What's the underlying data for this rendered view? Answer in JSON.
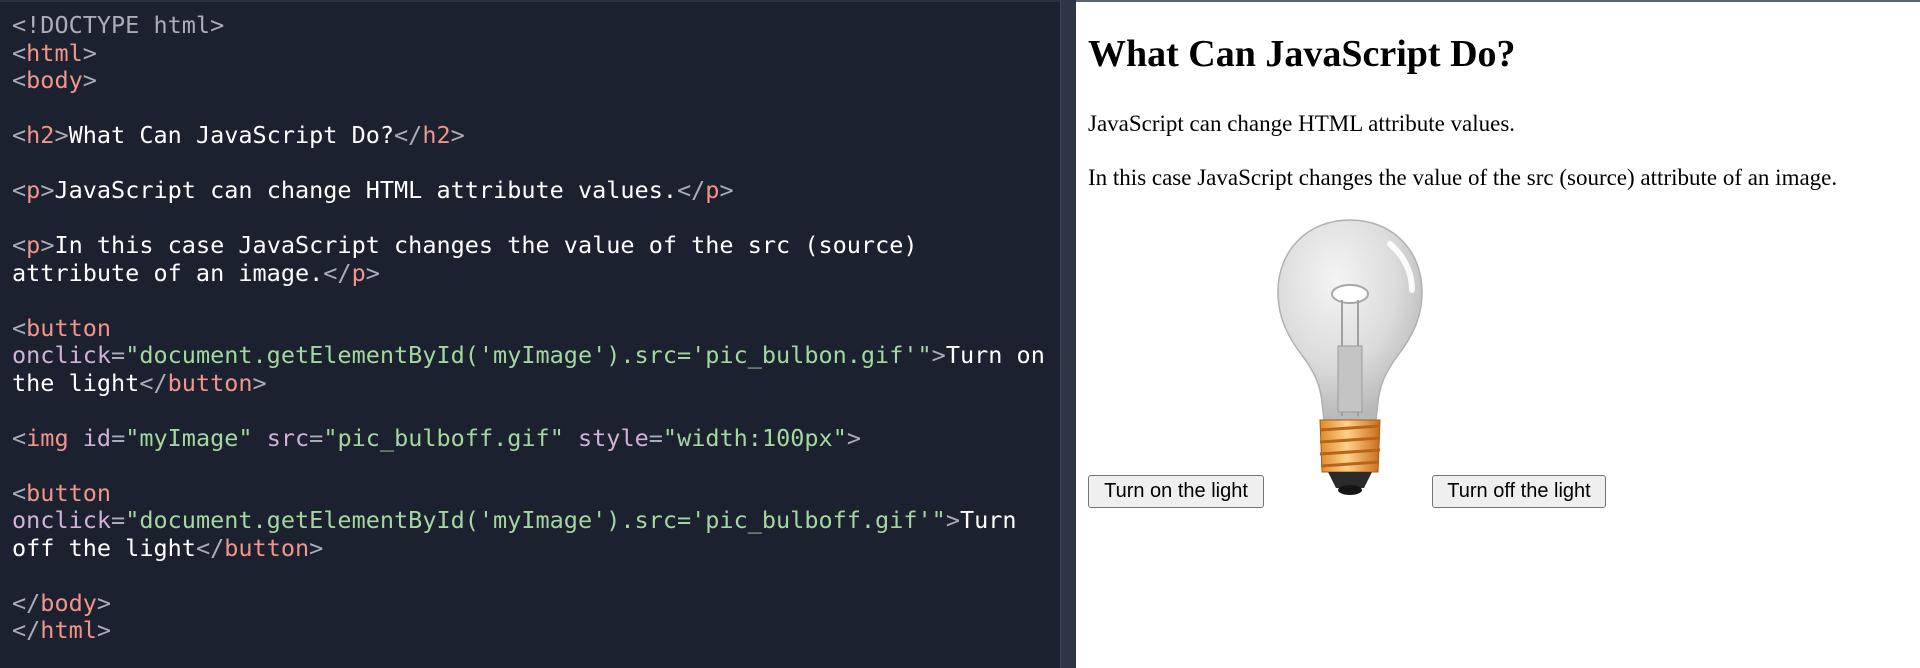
{
  "editor": {
    "lines": [
      [
        {
          "t": "doc",
          "v": "<!DOCTYPE html>"
        }
      ],
      [
        {
          "t": "brk",
          "v": "<"
        },
        {
          "t": "tag",
          "v": "html"
        },
        {
          "t": "brk",
          "v": ">"
        }
      ],
      [
        {
          "t": "brk",
          "v": "<"
        },
        {
          "t": "tag",
          "v": "body"
        },
        {
          "t": "brk",
          "v": ">"
        }
      ],
      [],
      [
        {
          "t": "brk",
          "v": "<"
        },
        {
          "t": "tag",
          "v": "h2"
        },
        {
          "t": "brk",
          "v": ">"
        },
        {
          "t": "txt",
          "v": "What Can JavaScript Do?"
        },
        {
          "t": "brk",
          "v": "</"
        },
        {
          "t": "tag",
          "v": "h2"
        },
        {
          "t": "brk",
          "v": ">"
        }
      ],
      [],
      [
        {
          "t": "brk",
          "v": "<"
        },
        {
          "t": "tag",
          "v": "p"
        },
        {
          "t": "brk",
          "v": ">"
        },
        {
          "t": "txt",
          "v": "JavaScript can change HTML attribute values."
        },
        {
          "t": "brk",
          "v": "</"
        },
        {
          "t": "tag",
          "v": "p"
        },
        {
          "t": "brk",
          "v": ">"
        }
      ],
      [],
      [
        {
          "t": "brk",
          "v": "<"
        },
        {
          "t": "tag",
          "v": "p"
        },
        {
          "t": "brk",
          "v": ">"
        },
        {
          "t": "txt",
          "v": "In this case JavaScript changes the value of the src (source)"
        }
      ],
      [
        {
          "t": "txt",
          "v": "attribute of an image."
        },
        {
          "t": "brk",
          "v": "</"
        },
        {
          "t": "tag",
          "v": "p"
        },
        {
          "t": "brk",
          "v": ">"
        }
      ],
      [],
      [
        {
          "t": "brk",
          "v": "<"
        },
        {
          "t": "tag",
          "v": "button"
        }
      ],
      [
        {
          "t": "attr",
          "v": "onclick"
        },
        {
          "t": "brk",
          "v": "="
        },
        {
          "t": "str",
          "v": "\"document.getElementById('myImage').src='pic_bulbon.gif'\""
        },
        {
          "t": "brk",
          "v": ">"
        },
        {
          "t": "txt",
          "v": "Turn on"
        }
      ],
      [
        {
          "t": "txt",
          "v": "the light"
        },
        {
          "t": "brk",
          "v": "</"
        },
        {
          "t": "tag",
          "v": "button"
        },
        {
          "t": "brk",
          "v": ">"
        }
      ],
      [],
      [
        {
          "t": "brk",
          "v": "<"
        },
        {
          "t": "tag",
          "v": "img"
        },
        {
          "t": "txt",
          "v": " "
        },
        {
          "t": "attr",
          "v": "id"
        },
        {
          "t": "brk",
          "v": "="
        },
        {
          "t": "str",
          "v": "\"myImage\""
        },
        {
          "t": "txt",
          "v": " "
        },
        {
          "t": "attr",
          "v": "src"
        },
        {
          "t": "brk",
          "v": "="
        },
        {
          "t": "str",
          "v": "\"pic_bulboff.gif\""
        },
        {
          "t": "txt",
          "v": " "
        },
        {
          "t": "attr",
          "v": "style"
        },
        {
          "t": "brk",
          "v": "="
        },
        {
          "t": "str",
          "v": "\"width:100px\""
        },
        {
          "t": "brk",
          "v": ">"
        }
      ],
      [],
      [
        {
          "t": "brk",
          "v": "<"
        },
        {
          "t": "tag",
          "v": "button"
        }
      ],
      [
        {
          "t": "attr",
          "v": "onclick"
        },
        {
          "t": "brk",
          "v": "="
        },
        {
          "t": "str",
          "v": "\"document.getElementById('myImage').src='pic_bulboff.gif'\""
        },
        {
          "t": "brk",
          "v": ">"
        },
        {
          "t": "txt",
          "v": "Turn"
        }
      ],
      [
        {
          "t": "txt",
          "v": "off the light"
        },
        {
          "t": "brk",
          "v": "</"
        },
        {
          "t": "tag",
          "v": "button"
        },
        {
          "t": "brk",
          "v": ">"
        }
      ],
      [],
      [
        {
          "t": "brk",
          "v": "</"
        },
        {
          "t": "tag",
          "v": "body"
        },
        {
          "t": "brk",
          "v": ">"
        }
      ],
      [
        {
          "t": "brk",
          "v": "</"
        },
        {
          "t": "tag",
          "v": "html"
        },
        {
          "t": "brk",
          "v": ">"
        }
      ]
    ]
  },
  "result": {
    "heading": "What Can JavaScript Do?",
    "paragraph1": "JavaScript can change HTML attribute values.",
    "paragraph2": "In this case JavaScript changes the value of the src (source) attribute of an image.",
    "button_on_label": "Turn on the light",
    "button_off_label": "Turn off the light",
    "image_icon": "light-bulb-off-icon"
  },
  "colors": {
    "editor_bg": "#1c2130",
    "tag": "#f2948a",
    "attribute": "#d2b0d8",
    "string": "#a3d7a0",
    "bracket": "#a9aeb6",
    "text": "#ffffff"
  }
}
